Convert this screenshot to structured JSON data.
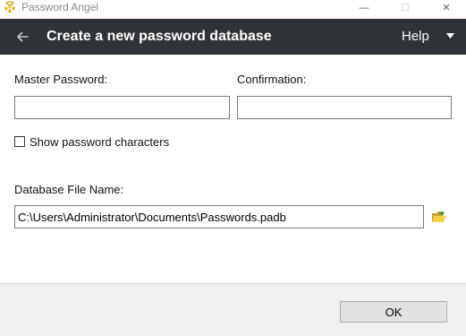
{
  "window": {
    "title": "Password Angel",
    "minimize_glyph": "—",
    "maximize_glyph": "☐",
    "close_glyph": "✕"
  },
  "header": {
    "title": "Create a new password database",
    "help_label": "Help",
    "background_color": "#2f3337"
  },
  "form": {
    "master_password_label": "Master Password:",
    "master_password_value": "",
    "confirmation_label": "Confirmation:",
    "confirmation_value": "",
    "show_password_label": "Show password characters",
    "show_password_checked": false,
    "database_file_label": "Database File Name:",
    "database_file_value": "C:\\Users\\Administrator\\Documents\\Passwords.padb"
  },
  "footer": {
    "ok_label": "OK"
  },
  "icons": {
    "app": "angel-icon",
    "back": "back-arrow-icon",
    "help_caret": "caret-down-icon",
    "browse": "folder-open-icon"
  }
}
